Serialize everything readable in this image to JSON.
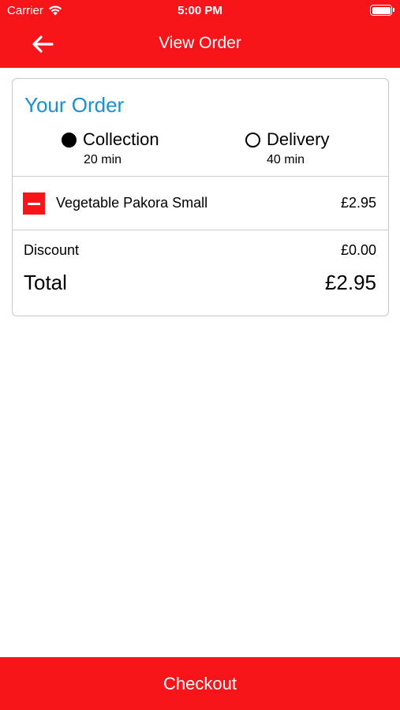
{
  "status_bar": {
    "carrier": "Carrier",
    "time": "5:00 PM"
  },
  "nav": {
    "title": "View Order",
    "back_icon": "arrow-left-icon"
  },
  "order": {
    "title": "Your Order",
    "options": [
      {
        "label": "Collection",
        "time": "20 min",
        "selected": true
      },
      {
        "label": "Delivery",
        "time": "40 min",
        "selected": false
      }
    ],
    "items": [
      {
        "name": "Vegetable Pakora Small",
        "price": "£2.95"
      }
    ],
    "discount_label": "Discount",
    "discount_value": "£0.00",
    "total_label": "Total",
    "total_value": "£2.95"
  },
  "checkout_label": "Checkout",
  "colors": {
    "brand_red": "#f8151a",
    "title_blue": "#1a8fd4"
  }
}
